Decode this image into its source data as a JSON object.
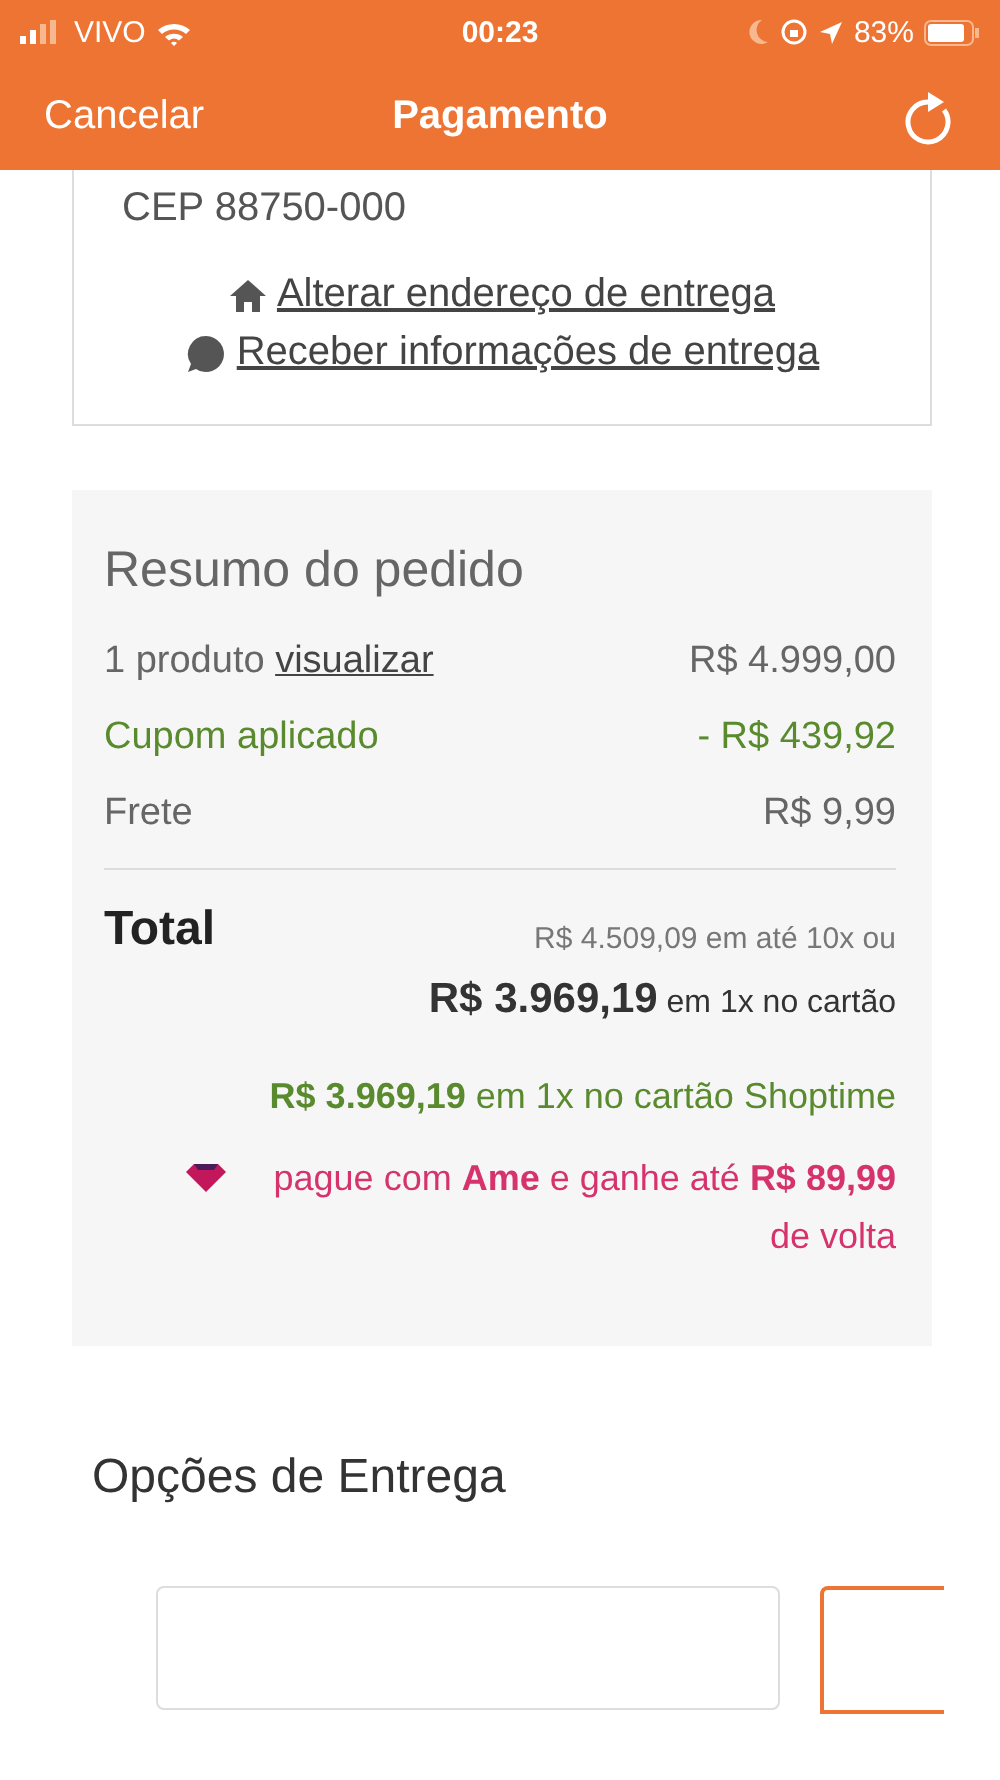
{
  "status_bar": {
    "carrier": "VIVO",
    "time": "00:23",
    "battery": "83%"
  },
  "header": {
    "cancel": "Cancelar",
    "title": "Pagamento"
  },
  "address": {
    "cep": "CEP 88750-000",
    "links": [
      {
        "kind": "home",
        "label": " Alterar endereço de entrega"
      },
      {
        "kind": "chat",
        "label": " Receber informações de entrega"
      }
    ]
  },
  "summary": {
    "title": "Resumo do pedido",
    "rows": [
      {
        "kind": "normal",
        "label": "1 produto",
        "link": "visualizar",
        "value": "R$ 4.999,00"
      },
      {
        "kind": "discount",
        "label": "Cupom aplicado",
        "value": "- R$ 439,92"
      },
      {
        "kind": "normal",
        "label": "Frete",
        "value": "R$ 9,99"
      }
    ],
    "total_label": "Total",
    "installments": "R$ 4.509,09 em até 10x ou",
    "cash": "**R$ 3.969,19** em 1x no cartão",
    "store_card": "**R$ 3.969,19** em 1x no cartão Shoptime",
    "ame": "pague com **Ame** e ganhe até **R$ 89,99** de volta"
  },
  "delivery": {
    "title": "Opções de Entrega"
  }
}
